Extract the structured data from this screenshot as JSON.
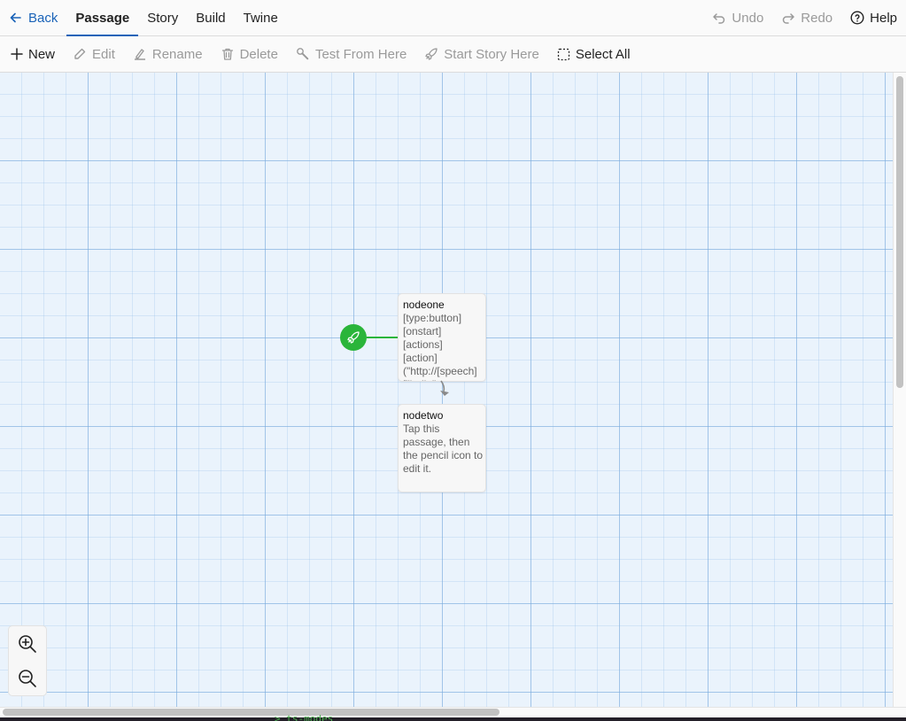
{
  "topbar": {
    "back_label": "Back",
    "tabs": [
      {
        "label": "Passage",
        "active": true
      },
      {
        "label": "Story",
        "active": false
      },
      {
        "label": "Build",
        "active": false
      },
      {
        "label": "Twine",
        "active": false
      }
    ],
    "undo_label": "Undo",
    "redo_label": "Redo",
    "help_label": "Help"
  },
  "toolbar": {
    "new_label": "New",
    "edit_label": "Edit",
    "rename_label": "Rename",
    "delete_label": "Delete",
    "test_label": "Test From Here",
    "start_label": "Start Story Here",
    "select_all_label": "Select All"
  },
  "passages": [
    {
      "title": "nodeone",
      "excerpt": "[type:button]\n[onstart]\n[actions]\n[action]\n(\"http://[speech]\n[\"hello\"",
      "is_start": true
    },
    {
      "title": "nodetwo",
      "excerpt": "Tap this passage, then the pencil icon to edit it.",
      "is_start": false
    }
  ],
  "background_text": "> ts-modes",
  "colors": {
    "accent": "#1a63b8",
    "start": "#2ab53a",
    "canvas": "#eaf3fc"
  },
  "icons": {
    "back": "arrow-left-icon",
    "undo": "undo-icon",
    "redo": "redo-icon",
    "help": "help-circle-icon",
    "new": "plus-icon",
    "edit": "pencil-icon",
    "rename": "rename-icon",
    "delete": "trash-icon",
    "test": "tool-icon",
    "start": "rocket-icon",
    "select_all": "dashed-square-icon",
    "zoom_in": "zoom-in-icon",
    "zoom_out": "zoom-out-icon"
  }
}
